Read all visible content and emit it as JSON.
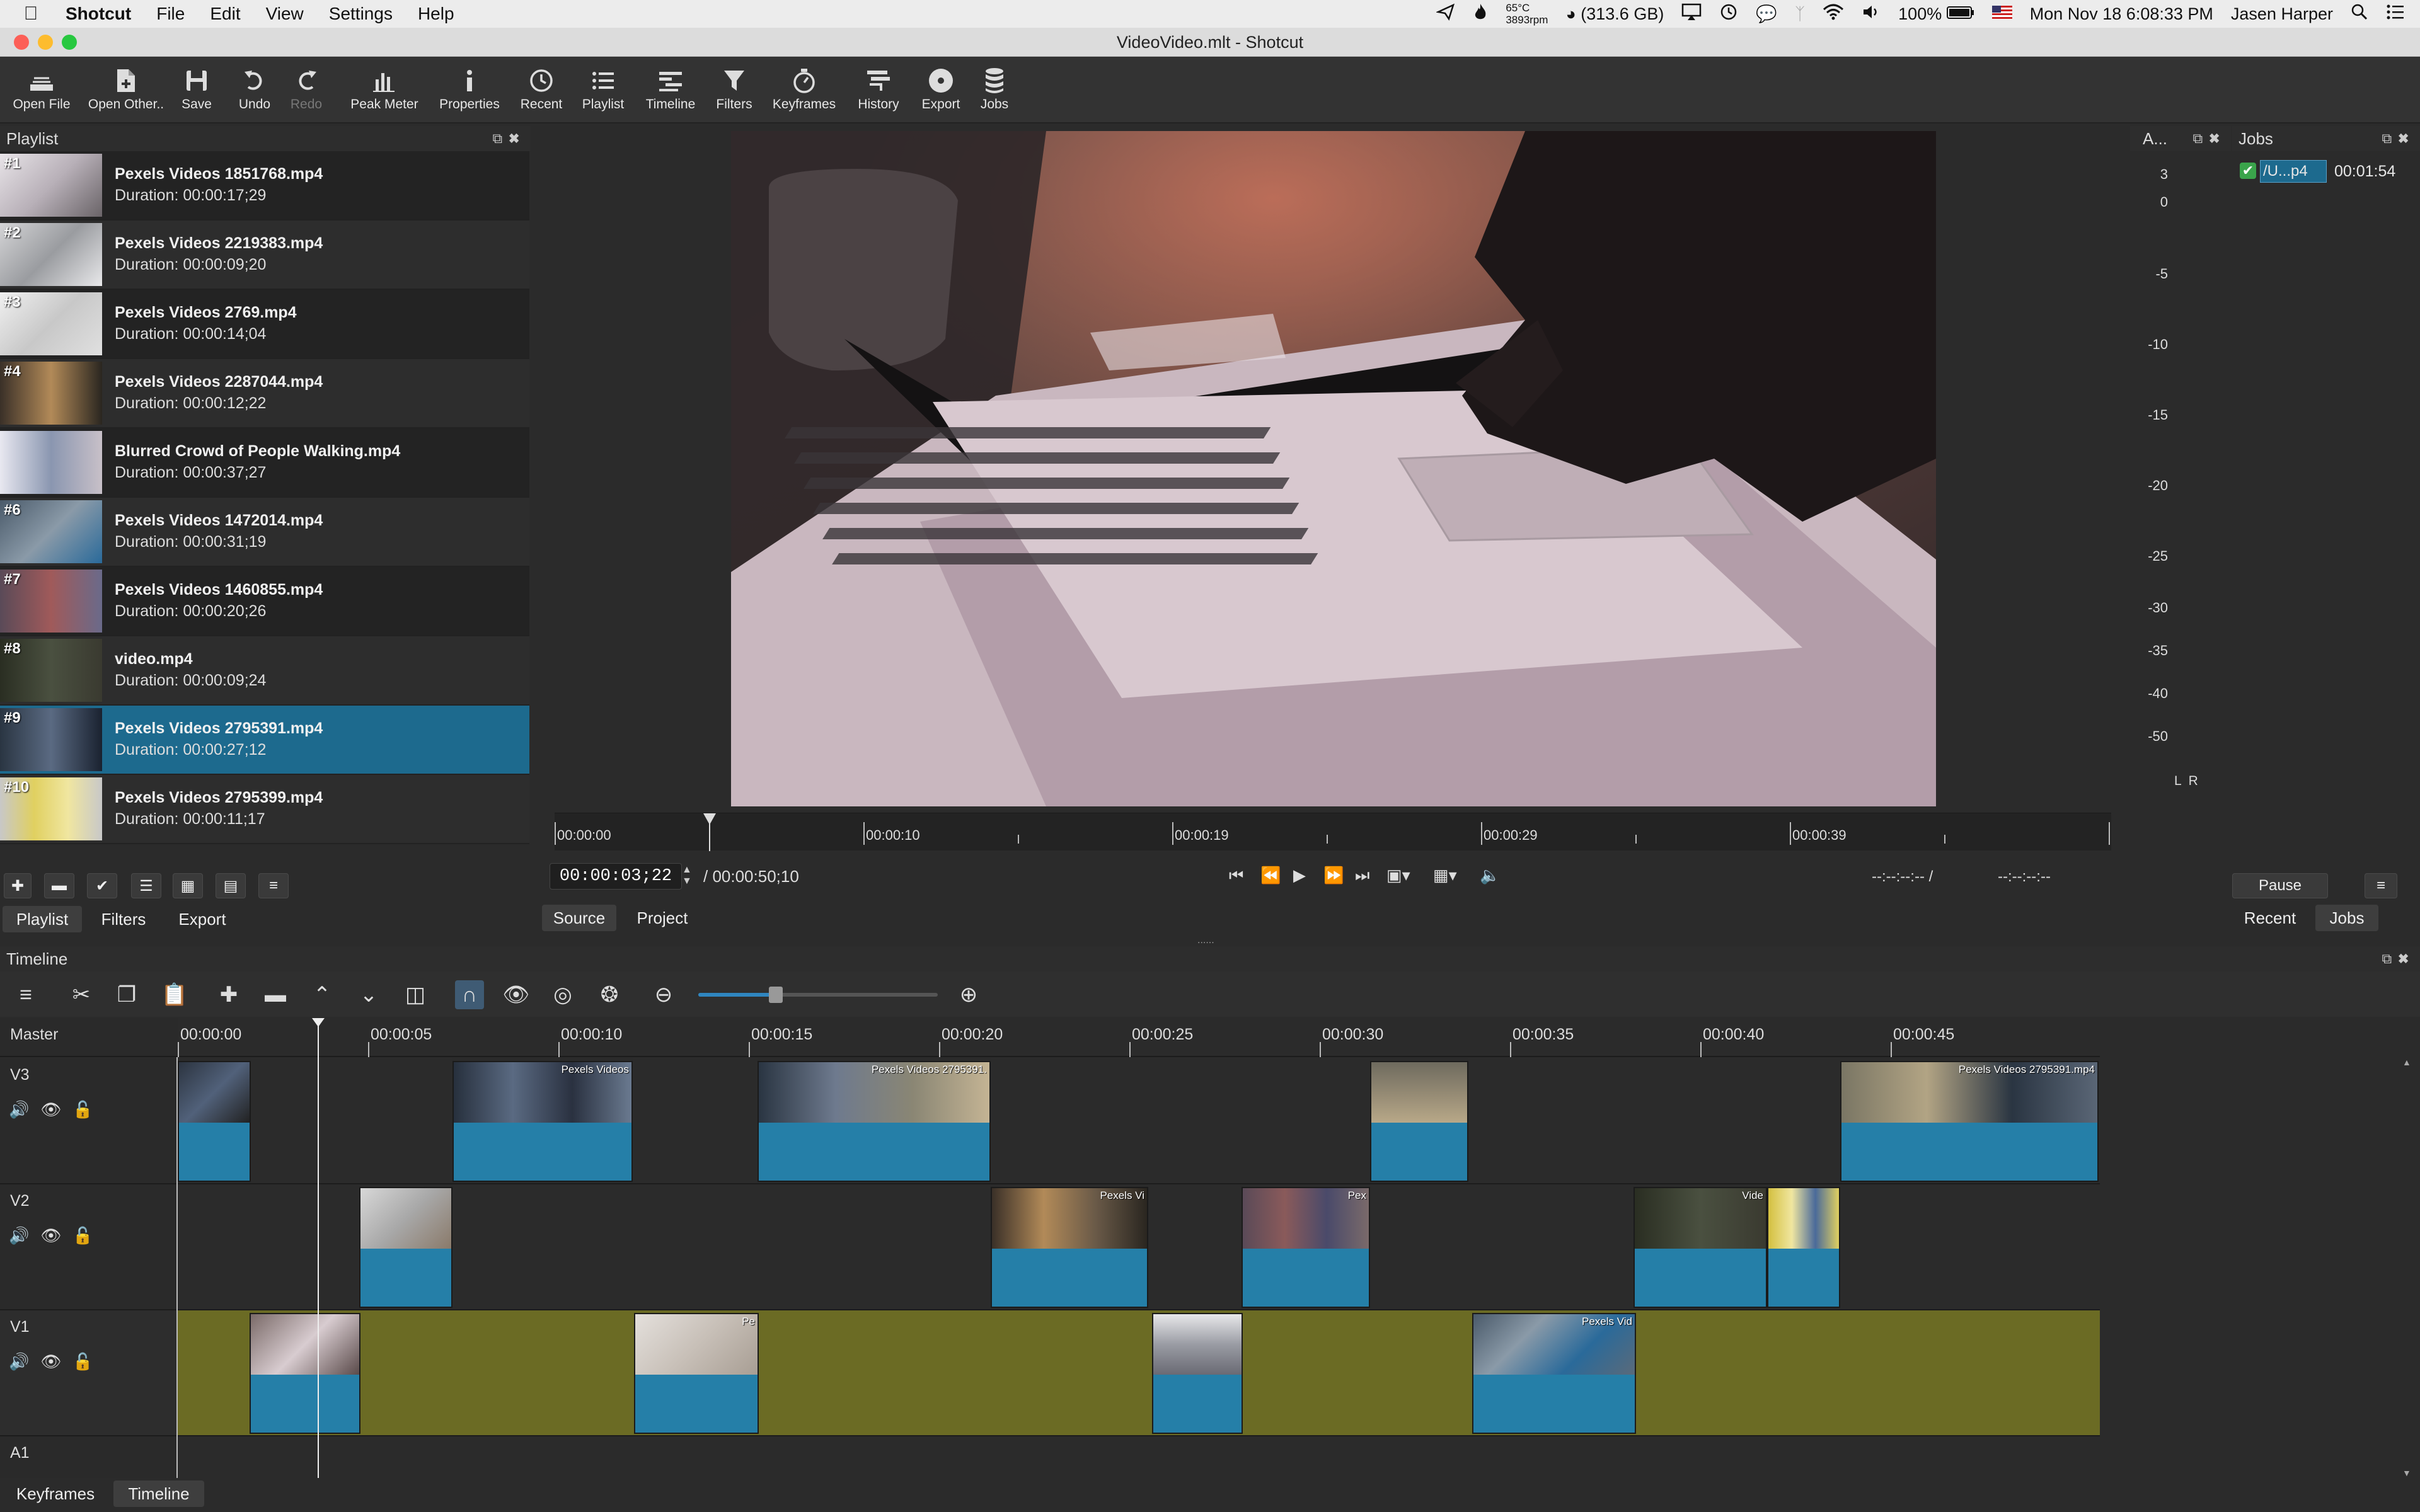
{
  "menubar": {
    "app_name": "Shotcut",
    "items": [
      "File",
      "Edit",
      "View",
      "Settings",
      "Help"
    ],
    "temperature": "65°C",
    "fan": "3893rpm",
    "disk": "(313.6 GB)",
    "battery": "100%",
    "clock": "Mon Nov 18  6:08:33 PM",
    "user": "Jasen Harper"
  },
  "window": {
    "title": "VideoVideo.mlt - Shotcut"
  },
  "toolbar": {
    "open_file": "Open File",
    "open_other": "Open Other..",
    "save": "Save",
    "undo": "Undo",
    "redo": "Redo",
    "peak_meter": "Peak Meter",
    "properties": "Properties",
    "recent": "Recent",
    "playlist": "Playlist",
    "timeline": "Timeline",
    "filters": "Filters",
    "keyframes": "Keyframes",
    "history": "History",
    "export": "Export",
    "jobs": "Jobs"
  },
  "playlist": {
    "title": "Playlist",
    "items": [
      {
        "num": "#1",
        "name": "Pexels Videos 1851768.mp4",
        "duration": "Duration: 00:00:17;29"
      },
      {
        "num": "#2",
        "name": "Pexels Videos 2219383.mp4",
        "duration": "Duration: 00:00:09;20"
      },
      {
        "num": "#3",
        "name": "Pexels Videos 2769.mp4",
        "duration": "Duration: 00:00:14;04"
      },
      {
        "num": "#4",
        "name": "Pexels Videos 2287044.mp4",
        "duration": "Duration: 00:00:12;22"
      },
      {
        "num": "",
        "name": "Blurred Crowd of People Walking.mp4",
        "duration": "Duration: 00:00:37;27"
      },
      {
        "num": "#6",
        "name": "Pexels Videos 1472014.mp4",
        "duration": "Duration: 00:00:31;19"
      },
      {
        "num": "#7",
        "name": "Pexels Videos 1460855.mp4",
        "duration": "Duration: 00:00:20;26"
      },
      {
        "num": "#8",
        "name": "video.mp4",
        "duration": "Duration: 00:00:09;24"
      },
      {
        "num": "#9",
        "name": "Pexels Videos 2795391.mp4",
        "duration": "Duration: 00:00:27;12"
      },
      {
        "num": "#10",
        "name": "Pexels Videos 2795399.mp4",
        "duration": "Duration: 00:00:11;17"
      }
    ],
    "selected_index": 8,
    "tabs": [
      "Playlist",
      "Filters",
      "Export"
    ]
  },
  "viewer": {
    "ruler_labels": [
      "00:00:00",
      "00:00:10",
      "00:00:19",
      "00:00:29",
      "00:00:39"
    ],
    "timecode": "00:00:03;22",
    "total_duration": "/ 00:00:50;10",
    "in_point": "--:--:--:-- /",
    "out_point": "--:--:--:--",
    "tabs": [
      "Source",
      "Project"
    ]
  },
  "meter": {
    "title": "A...",
    "labels": [
      "3",
      "0",
      "-5",
      "-10",
      "-15",
      "-20",
      "-25",
      "-30",
      "-35",
      "-40",
      "-50"
    ],
    "channels": "L  R"
  },
  "jobs": {
    "title": "Jobs",
    "job_name": "/U...p4",
    "job_time": "00:01:54",
    "pause": "Pause",
    "tabs": [
      "Recent",
      "Jobs"
    ]
  },
  "timeline": {
    "title": "Timeline",
    "master": "Master",
    "ruler_labels": [
      "00:00:00",
      "00:00:05",
      "00:00:10",
      "00:00:15",
      "00:00:20",
      "00:00:25",
      "00:00:30",
      "00:00:35",
      "00:00:40",
      "00:00:45"
    ],
    "tracks": [
      "V3",
      "V2",
      "V1",
      "A1"
    ],
    "clip_labels": {
      "v3_b": "Pexels Videos",
      "v3_c": "Pexels Videos 2795391.",
      "v3_f": "Pexels Videos 2795391.mp4",
      "v2_b": "Pexels Vi",
      "v2_c": "Pex",
      "v2_d": "Vide",
      "v1_b": "Pe",
      "v1_d": "Pexels Vid"
    }
  },
  "bottom_tabs": [
    "Keyframes",
    "Timeline"
  ],
  "colors": {
    "accent": "#1d6a8e",
    "clip_blue": "#257fa8",
    "v1_track": "#6b6b24",
    "toolbar_bg": "#333333"
  }
}
